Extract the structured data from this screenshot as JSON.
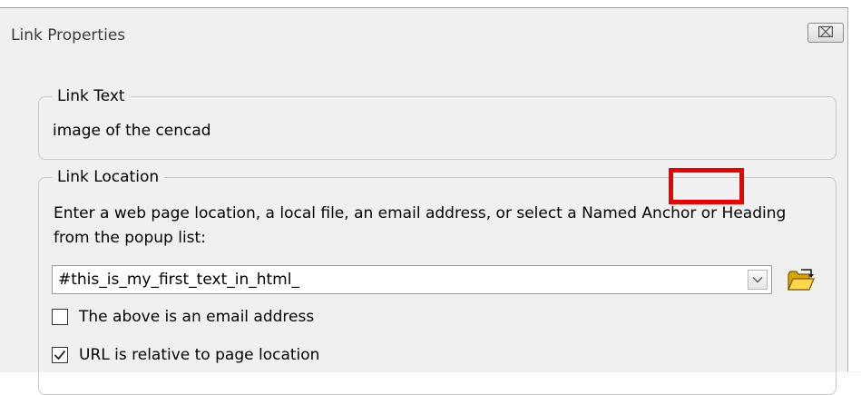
{
  "dialog": {
    "title": "Link Properties",
    "close_symbol": "⌧"
  },
  "link_text": {
    "legend": "Link Text",
    "value": "image of the cencad"
  },
  "link_location": {
    "legend": "Link Location",
    "instructions": "Enter a web page location, a local file, an email address, or select a Named Anchor or Heading from the popup list:",
    "url_value": "#this_is_my_first_text_in_html_",
    "dropdown_icon": "chevron-down-icon",
    "browse_icon": "folder-open-icon",
    "email_checkbox": {
      "label": "The above is an email address",
      "checked": false
    },
    "relative_checkbox": {
      "label": "URL is relative to page location",
      "checked": true
    }
  },
  "annotation": {
    "highlight_color": "#ee0000"
  },
  "colors": {
    "dialog_bg": "#f0f0f0",
    "border": "#c8c8c8",
    "highlight": "#ee0000"
  }
}
